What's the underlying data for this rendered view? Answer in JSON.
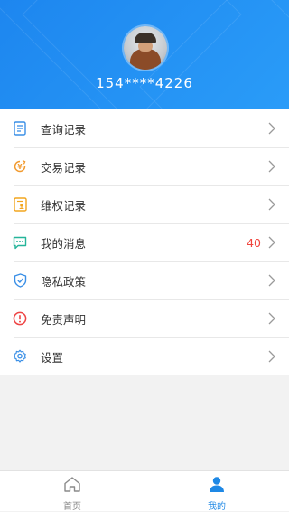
{
  "colors": {
    "header_start": "#1d86ef",
    "header_end": "#2a9cf8",
    "accent": "#1e88e5",
    "badge": "#f0443d",
    "inactive_tab": "#8a8a8a"
  },
  "profile": {
    "phone": "154****4226"
  },
  "menu": [
    {
      "label": "查询记录",
      "icon": "document-list-icon",
      "badge": ""
    },
    {
      "label": "交易记录",
      "icon": "yuan-coin-icon",
      "badge": ""
    },
    {
      "label": "维权记录",
      "icon": "rights-record-icon",
      "badge": ""
    },
    {
      "label": "我的消息",
      "icon": "message-bubble-icon",
      "badge": "40"
    },
    {
      "label": "隐私政策",
      "icon": "shield-check-icon",
      "badge": ""
    },
    {
      "label": "免责声明",
      "icon": "alert-circle-icon",
      "badge": ""
    },
    {
      "label": "设置",
      "icon": "gear-icon",
      "badge": ""
    }
  ],
  "tabs": [
    {
      "label": "首页",
      "icon": "home-icon",
      "active": false
    },
    {
      "label": "我的",
      "icon": "user-icon",
      "active": true
    }
  ]
}
